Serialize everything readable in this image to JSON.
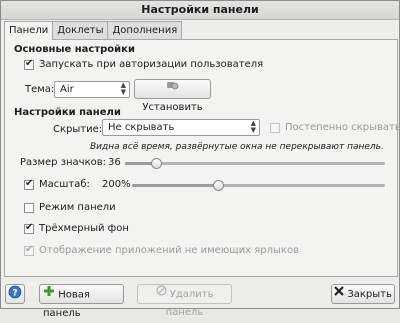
{
  "window": {
    "title": "Настройки панели"
  },
  "tabs": [
    {
      "label": "Панели"
    },
    {
      "label": "Доклеты"
    },
    {
      "label": "Дополнения"
    }
  ],
  "basic": {
    "heading": "Основные настройки",
    "autostart_label": "Запускать при авторизации пользователя",
    "autostart_checked": true,
    "theme_label": "Тема:",
    "theme_value": "Air",
    "install_label": "Установить"
  },
  "panel": {
    "heading": "Настройки панели",
    "hide_label": "Скрытие:",
    "hide_value": "Не скрывать",
    "gradual_label": "Постепенно скрывать",
    "gradual_checked": false,
    "hint": "Видна всё время, развёрнутые окна не перекрывают панель.",
    "icon_size_label": "Размер значков:",
    "icon_size_value": "36",
    "icon_size_fraction": 0.12,
    "scale_label": "Масштаб:",
    "scale_checked": true,
    "scale_value": "200%",
    "scale_fraction": 0.34,
    "panel_mode_label": "Режим панели",
    "panel_mode_checked": false,
    "threed_label": "Трёхмерный фон",
    "threed_checked": true,
    "show_apps_label": "Отображение приложений не имеющих ярлыков",
    "show_apps_checked": true
  },
  "footer": {
    "help_icon": "help-icon",
    "new_panel_label": "Новая панель",
    "delete_panel_label": "Удалить панель",
    "close_label": "Закрыть"
  }
}
